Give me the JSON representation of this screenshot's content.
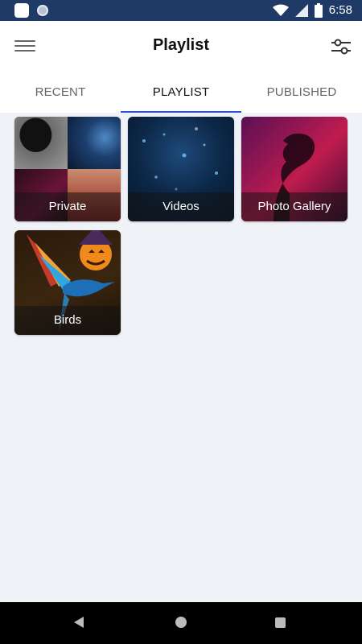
{
  "status_bar": {
    "time": "6:58",
    "icons": [
      "app-square-icon",
      "sync-circle-icon",
      "wifi-icon",
      "signal-icon",
      "battery-icon"
    ]
  },
  "app_bar": {
    "title": "Playlist",
    "menu_icon": "hamburger-menu-icon",
    "filter_icon": "filter-sliders-icon"
  },
  "tabs": [
    {
      "label": "RECENT",
      "active": false
    },
    {
      "label": "PLAYLIST",
      "active": true
    },
    {
      "label": "PUBLISHED",
      "active": false
    }
  ],
  "playlists": [
    {
      "label": "Private"
    },
    {
      "label": "Videos"
    },
    {
      "label": "Photo Gallery"
    },
    {
      "label": "Birds"
    }
  ],
  "nav_bar": {
    "icons": [
      "back-icon",
      "home-icon",
      "recent-apps-icon"
    ]
  },
  "colors": {
    "status_bar": "#1f3a66",
    "accent": "#2f55d4",
    "background": "#eff2f7"
  }
}
